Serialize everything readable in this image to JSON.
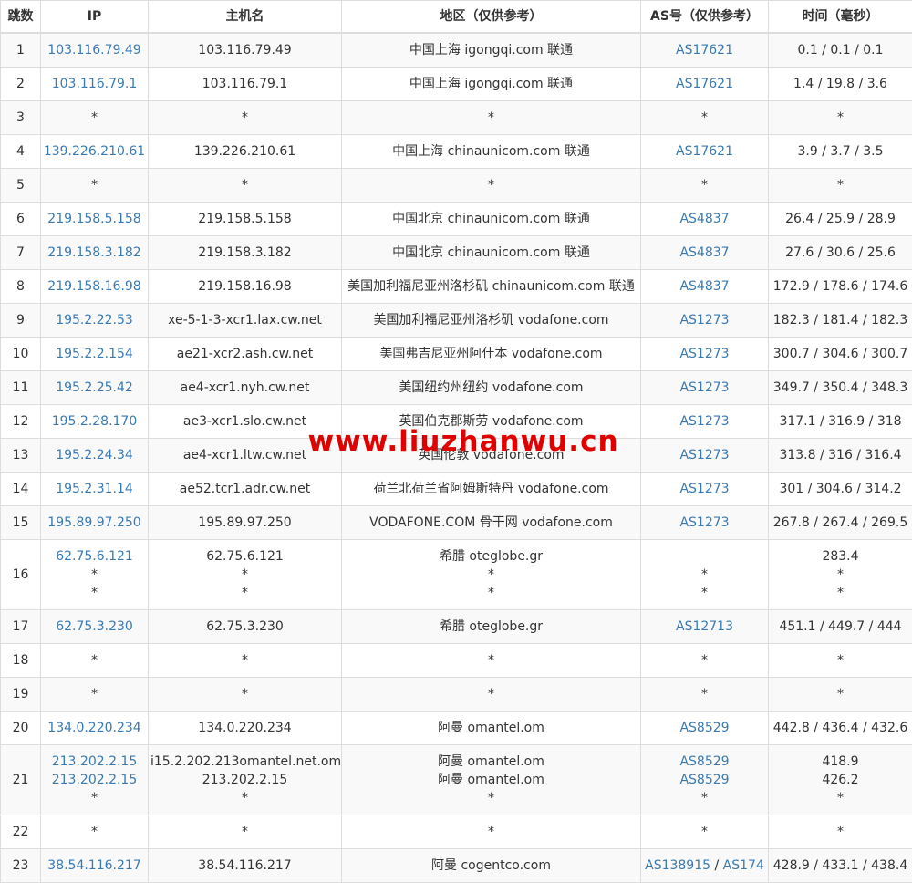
{
  "headers": {
    "hop": "跳数",
    "ip": "IP",
    "host": "主机名",
    "region": "地区（仅供参考）",
    "as": "AS号（仅供参考）",
    "time": "时间（毫秒）"
  },
  "rows": [
    {
      "hop": "1",
      "ip": [
        "103.116.79.49"
      ],
      "host": [
        "103.116.79.49"
      ],
      "region": [
        "中国上海 igongqi.com 联通"
      ],
      "as": [
        [
          "AS17621"
        ]
      ],
      "time": [
        "0.1 / 0.1 / 0.1"
      ]
    },
    {
      "hop": "2",
      "ip": [
        "103.116.79.1"
      ],
      "host": [
        "103.116.79.1"
      ],
      "region": [
        "中国上海 igongqi.com 联通"
      ],
      "as": [
        [
          "AS17621"
        ]
      ],
      "time": [
        "1.4 / 19.8 / 3.6"
      ]
    },
    {
      "hop": "3",
      "ip": [
        "*"
      ],
      "host": [
        "*"
      ],
      "region": [
        "*"
      ],
      "as": [
        [
          "*"
        ]
      ],
      "time": [
        "*"
      ]
    },
    {
      "hop": "4",
      "ip": [
        "139.226.210.61"
      ],
      "host": [
        "139.226.210.61"
      ],
      "region": [
        "中国上海 chinaunicom.com 联通"
      ],
      "as": [
        [
          "AS17621"
        ]
      ],
      "time": [
        "3.9 / 3.7 / 3.5"
      ]
    },
    {
      "hop": "5",
      "ip": [
        "*"
      ],
      "host": [
        "*"
      ],
      "region": [
        "*"
      ],
      "as": [
        [
          "*"
        ]
      ],
      "time": [
        "*"
      ]
    },
    {
      "hop": "6",
      "ip": [
        "219.158.5.158"
      ],
      "host": [
        "219.158.5.158"
      ],
      "region": [
        "中国北京 chinaunicom.com 联通"
      ],
      "as": [
        [
          "AS4837"
        ]
      ],
      "time": [
        "26.4 / 25.9 / 28.9"
      ]
    },
    {
      "hop": "7",
      "ip": [
        "219.158.3.182"
      ],
      "host": [
        "219.158.3.182"
      ],
      "region": [
        "中国北京 chinaunicom.com 联通"
      ],
      "as": [
        [
          "AS4837"
        ]
      ],
      "time": [
        "27.6 / 30.6 / 25.6"
      ]
    },
    {
      "hop": "8",
      "ip": [
        "219.158.16.98"
      ],
      "host": [
        "219.158.16.98"
      ],
      "region": [
        "美国加利福尼亚州洛杉矶 chinaunicom.com 联通"
      ],
      "as": [
        [
          "AS4837"
        ]
      ],
      "time": [
        "172.9 / 178.6 / 174.6"
      ]
    },
    {
      "hop": "9",
      "ip": [
        "195.2.22.53"
      ],
      "host": [
        "xe-5-1-3-xcr1.lax.cw.net"
      ],
      "region": [
        "美国加利福尼亚州洛杉矶 vodafone.com"
      ],
      "as": [
        [
          "AS1273"
        ]
      ],
      "time": [
        "182.3 / 181.4 / 182.3"
      ]
    },
    {
      "hop": "10",
      "ip": [
        "195.2.2.154"
      ],
      "host": [
        "ae21-xcr2.ash.cw.net"
      ],
      "region": [
        "美国弗吉尼亚州阿什本 vodafone.com"
      ],
      "as": [
        [
          "AS1273"
        ]
      ],
      "time": [
        "300.7 / 304.6 / 300.7"
      ]
    },
    {
      "hop": "11",
      "ip": [
        "195.2.25.42"
      ],
      "host": [
        "ae4-xcr1.nyh.cw.net"
      ],
      "region": [
        "美国纽约州纽约 vodafone.com"
      ],
      "as": [
        [
          "AS1273"
        ]
      ],
      "time": [
        "349.7 / 350.4 / 348.3"
      ]
    },
    {
      "hop": "12",
      "ip": [
        "195.2.28.170"
      ],
      "host": [
        "ae3-xcr1.slo.cw.net"
      ],
      "region": [
        "英国伯克郡斯劳 vodafone.com"
      ],
      "as": [
        [
          "AS1273"
        ]
      ],
      "time": [
        "317.1 / 316.9 / 318"
      ]
    },
    {
      "hop": "13",
      "ip": [
        "195.2.24.34"
      ],
      "host": [
        "ae4-xcr1.ltw.cw.net"
      ],
      "region": [
        "英国伦敦 vodafone.com"
      ],
      "as": [
        [
          "AS1273"
        ]
      ],
      "time": [
        "313.8 / 316 / 316.4"
      ]
    },
    {
      "hop": "14",
      "ip": [
        "195.2.31.14"
      ],
      "host": [
        "ae52.tcr1.adr.cw.net"
      ],
      "region": [
        "荷兰北荷兰省阿姆斯特丹 vodafone.com"
      ],
      "as": [
        [
          "AS1273"
        ]
      ],
      "time": [
        "301 / 304.6 / 314.2"
      ]
    },
    {
      "hop": "15",
      "ip": [
        "195.89.97.250"
      ],
      "host": [
        "195.89.97.250"
      ],
      "region": [
        "VODAFONE.COM 骨干网 vodafone.com"
      ],
      "as": [
        [
          "AS1273"
        ]
      ],
      "time": [
        "267.8 / 267.4 / 269.5"
      ]
    },
    {
      "hop": "16",
      "ip": [
        "62.75.6.121",
        "*",
        "*"
      ],
      "host": [
        "62.75.6.121",
        "*",
        "*"
      ],
      "region": [
        "希腊 oteglobe.gr",
        "*",
        "*"
      ],
      "as": [
        [
          ""
        ],
        [
          "*"
        ],
        [
          "*"
        ]
      ],
      "time": [
        "283.4",
        "*",
        "*"
      ]
    },
    {
      "hop": "17",
      "ip": [
        "62.75.3.230"
      ],
      "host": [
        "62.75.3.230"
      ],
      "region": [
        "希腊 oteglobe.gr"
      ],
      "as": [
        [
          "AS12713"
        ]
      ],
      "time": [
        "451.1 / 449.7 / 444"
      ]
    },
    {
      "hop": "18",
      "ip": [
        "*"
      ],
      "host": [
        "*"
      ],
      "region": [
        "*"
      ],
      "as": [
        [
          "*"
        ]
      ],
      "time": [
        "*"
      ]
    },
    {
      "hop": "19",
      "ip": [
        "*"
      ],
      "host": [
        "*"
      ],
      "region": [
        "*"
      ],
      "as": [
        [
          "*"
        ]
      ],
      "time": [
        "*"
      ]
    },
    {
      "hop": "20",
      "ip": [
        "134.0.220.234"
      ],
      "host": [
        "134.0.220.234"
      ],
      "region": [
        "阿曼 omantel.om"
      ],
      "as": [
        [
          "AS8529"
        ]
      ],
      "time": [
        "442.8 / 436.4 / 432.6"
      ]
    },
    {
      "hop": "21",
      "ip": [
        "213.202.2.15",
        "213.202.2.15",
        "*"
      ],
      "host": [
        "i15.2.202.213omantel.net.om",
        "213.202.2.15",
        "*"
      ],
      "region": [
        "阿曼 omantel.om",
        "阿曼 omantel.om",
        "*"
      ],
      "as": [
        [
          "AS8529"
        ],
        [
          "AS8529"
        ],
        [
          "*"
        ]
      ],
      "time": [
        "418.9",
        "426.2",
        "*"
      ]
    },
    {
      "hop": "22",
      "ip": [
        "*"
      ],
      "host": [
        "*"
      ],
      "region": [
        "*"
      ],
      "as": [
        [
          "*"
        ]
      ],
      "time": [
        "*"
      ]
    },
    {
      "hop": "23",
      "ip": [
        "38.54.116.217"
      ],
      "host": [
        "38.54.116.217"
      ],
      "region": [
        "阿曼 cogentco.com"
      ],
      "as": [
        [
          "AS138915",
          "AS174"
        ]
      ],
      "time": [
        "428.9 / 433.1 / 438.4"
      ]
    }
  ],
  "as_separator": " / ",
  "watermark": "www.liuzhanwu.cn"
}
